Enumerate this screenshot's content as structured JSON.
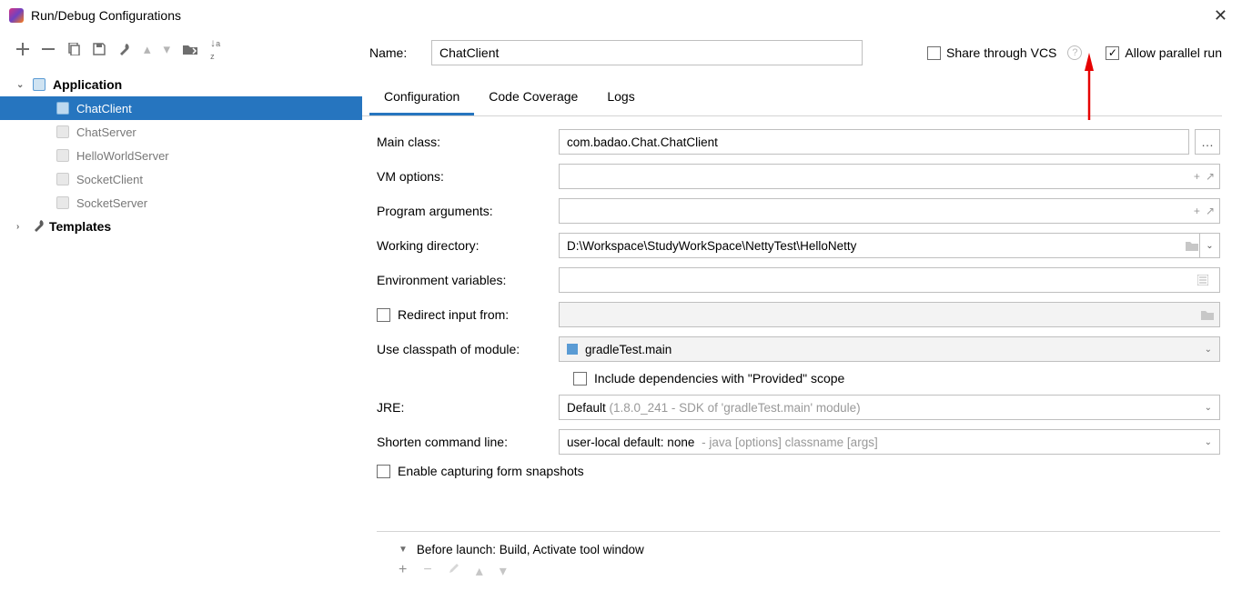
{
  "window": {
    "title": "Run/Debug Configurations"
  },
  "tree": {
    "application_label": "Application",
    "templates_label": "Templates",
    "items": [
      "ChatClient",
      "ChatServer",
      "HelloWorldServer",
      "SocketClient",
      "SocketServer"
    ],
    "selected": "ChatClient"
  },
  "name_label": "Name:",
  "name_value": "ChatClient",
  "share_label": "Share through VCS",
  "allow_parallel_label": "Allow parallel run",
  "tabs": {
    "configuration": "Configuration",
    "coverage": "Code Coverage",
    "logs": "Logs"
  },
  "form": {
    "main_class_label": "Main class:",
    "main_class_value": "com.badao.Chat.ChatClient",
    "vm_options_label": "VM options:",
    "vm_options_value": "",
    "prog_args_label": "Program arguments:",
    "prog_args_value": "",
    "work_dir_label": "Working directory:",
    "work_dir_value": "D:\\Workspace\\StudyWorkSpace\\NettyTest\\HelloNetty",
    "env_vars_label": "Environment variables:",
    "env_vars_value": "",
    "redirect_label": "Redirect input from:",
    "redirect_value": "",
    "classpath_label": "Use classpath of module:",
    "classpath_value": "gradleTest.main",
    "include_provided_label": "Include dependencies with \"Provided\" scope",
    "jre_label": "JRE:",
    "jre_prefix": "Default",
    "jre_hint": "(1.8.0_241 - SDK of 'gradleTest.main' module)",
    "shorten_label": "Shorten command line:",
    "shorten_prefix": "user-local default: none",
    "shorten_hint": "- java [options] classname [args]",
    "enable_snapshots_label": "Enable capturing form snapshots"
  },
  "before_launch_label": "Before launch: Build, Activate tool window"
}
